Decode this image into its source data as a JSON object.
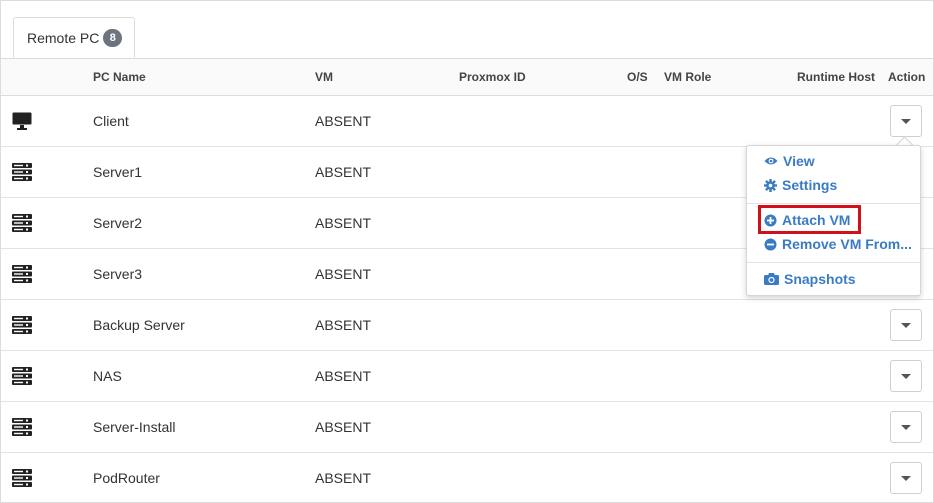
{
  "tab": {
    "label": "Remote PC",
    "count": "8"
  },
  "columns": {
    "pc_name": "PC Name",
    "vm": "VM",
    "proxmox_id": "Proxmox ID",
    "os": "O/S",
    "vm_role": "VM Role",
    "runtime_host": "Runtime Host",
    "action": "Action"
  },
  "rows": [
    {
      "icon": "desktop-icon",
      "name": "Client",
      "vm": "ABSENT"
    },
    {
      "icon": "server-icon",
      "name": "Server1",
      "vm": "ABSENT"
    },
    {
      "icon": "server-icon",
      "name": "Server2",
      "vm": "ABSENT"
    },
    {
      "icon": "server-icon",
      "name": "Server3",
      "vm": "ABSENT"
    },
    {
      "icon": "server-icon",
      "name": "Backup Server",
      "vm": "ABSENT"
    },
    {
      "icon": "server-icon",
      "name": "NAS",
      "vm": "ABSENT"
    },
    {
      "icon": "server-icon",
      "name": "Server-Install",
      "vm": "ABSENT"
    },
    {
      "icon": "server-icon",
      "name": "PodRouter",
      "vm": "ABSENT"
    }
  ],
  "action_menu": {
    "view": "View",
    "settings": "Settings",
    "attach_vm": "Attach VM",
    "remove_vm": "Remove VM From...",
    "snapshots": "Snapshots"
  },
  "colors": {
    "link": "#3a7cc4",
    "highlight": "#d0111b",
    "badge": "#6c7480"
  }
}
